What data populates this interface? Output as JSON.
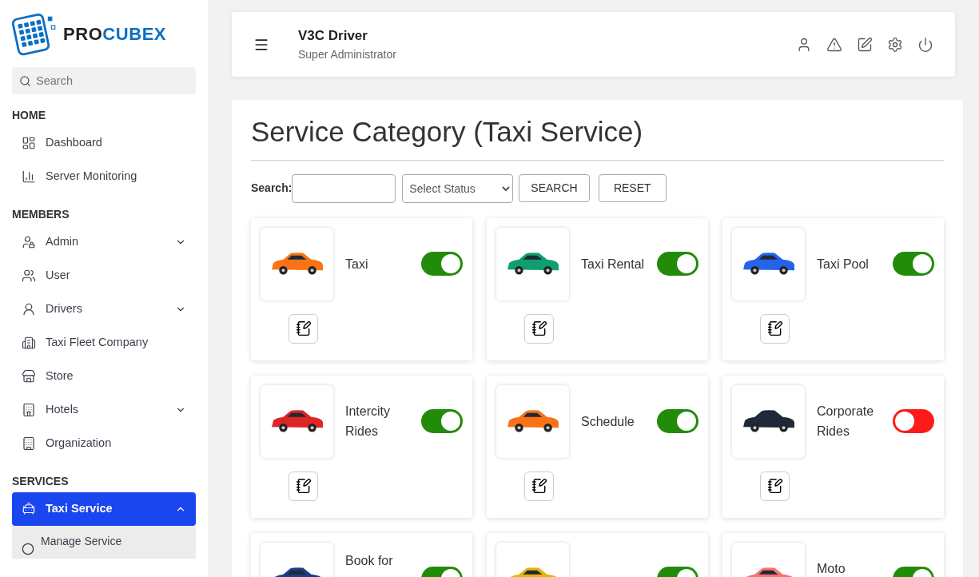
{
  "logo": {
    "dark_part": "PRO",
    "blue_part": "CUBEX"
  },
  "sidebar": {
    "search": {
      "placeholder": "Search"
    },
    "sections": [
      {
        "title": "HOME",
        "items": [
          {
            "label": "Dashboard",
            "expandable": false,
            "selected": false
          },
          {
            "label": "Server Monitoring",
            "expandable": false,
            "selected": false
          }
        ]
      },
      {
        "title": "MEMBERS",
        "items": [
          {
            "label": "Admin",
            "expandable": true,
            "selected": false
          },
          {
            "label": "User",
            "expandable": false,
            "selected": false
          },
          {
            "label": "Drivers",
            "expandable": true,
            "selected": false
          },
          {
            "label": "Taxi Fleet Company",
            "expandable": false,
            "selected": false
          },
          {
            "label": "Store",
            "expandable": false,
            "selected": false
          },
          {
            "label": "Hotels",
            "expandable": true,
            "selected": false
          },
          {
            "label": "Organization",
            "expandable": false,
            "selected": false
          }
        ]
      },
      {
        "title": "SERVICES",
        "items": [
          {
            "label": "Taxi Service",
            "expandable": true,
            "selected": true,
            "expanded": true,
            "children": [
              {
                "label": "Manage Service"
              }
            ]
          }
        ]
      }
    ]
  },
  "header": {
    "title": "V3C Driver",
    "subtitle": "Super Administrator"
  },
  "page": {
    "title": "Service Category (Taxi Service)",
    "filters": {
      "search_label": "Search:",
      "status_select": "Select Status",
      "buttons": [
        "SEARCH",
        "RESET"
      ]
    },
    "cards": [
      {
        "label": "Taxi",
        "on": true,
        "color": "#f97316"
      },
      {
        "label": "Taxi Rental",
        "on": true,
        "color": "#0f9f6e"
      },
      {
        "label": "Taxi Pool",
        "on": true,
        "color": "#2563eb"
      },
      {
        "label": "Intercity Rides",
        "on": true,
        "color": "#dc2626"
      },
      {
        "label": "Schedule",
        "on": true,
        "color": "#f97316"
      },
      {
        "label": "Corporate Rides",
        "on": false,
        "color": "#1f2937"
      },
      {
        "label": "Book for",
        "on": true,
        "color": "#1e3a8a"
      },
      {
        "on": true,
        "color": "#eab308"
      },
      {
        "label": "Moto",
        "on": true,
        "color": "#f87171"
      }
    ]
  }
}
